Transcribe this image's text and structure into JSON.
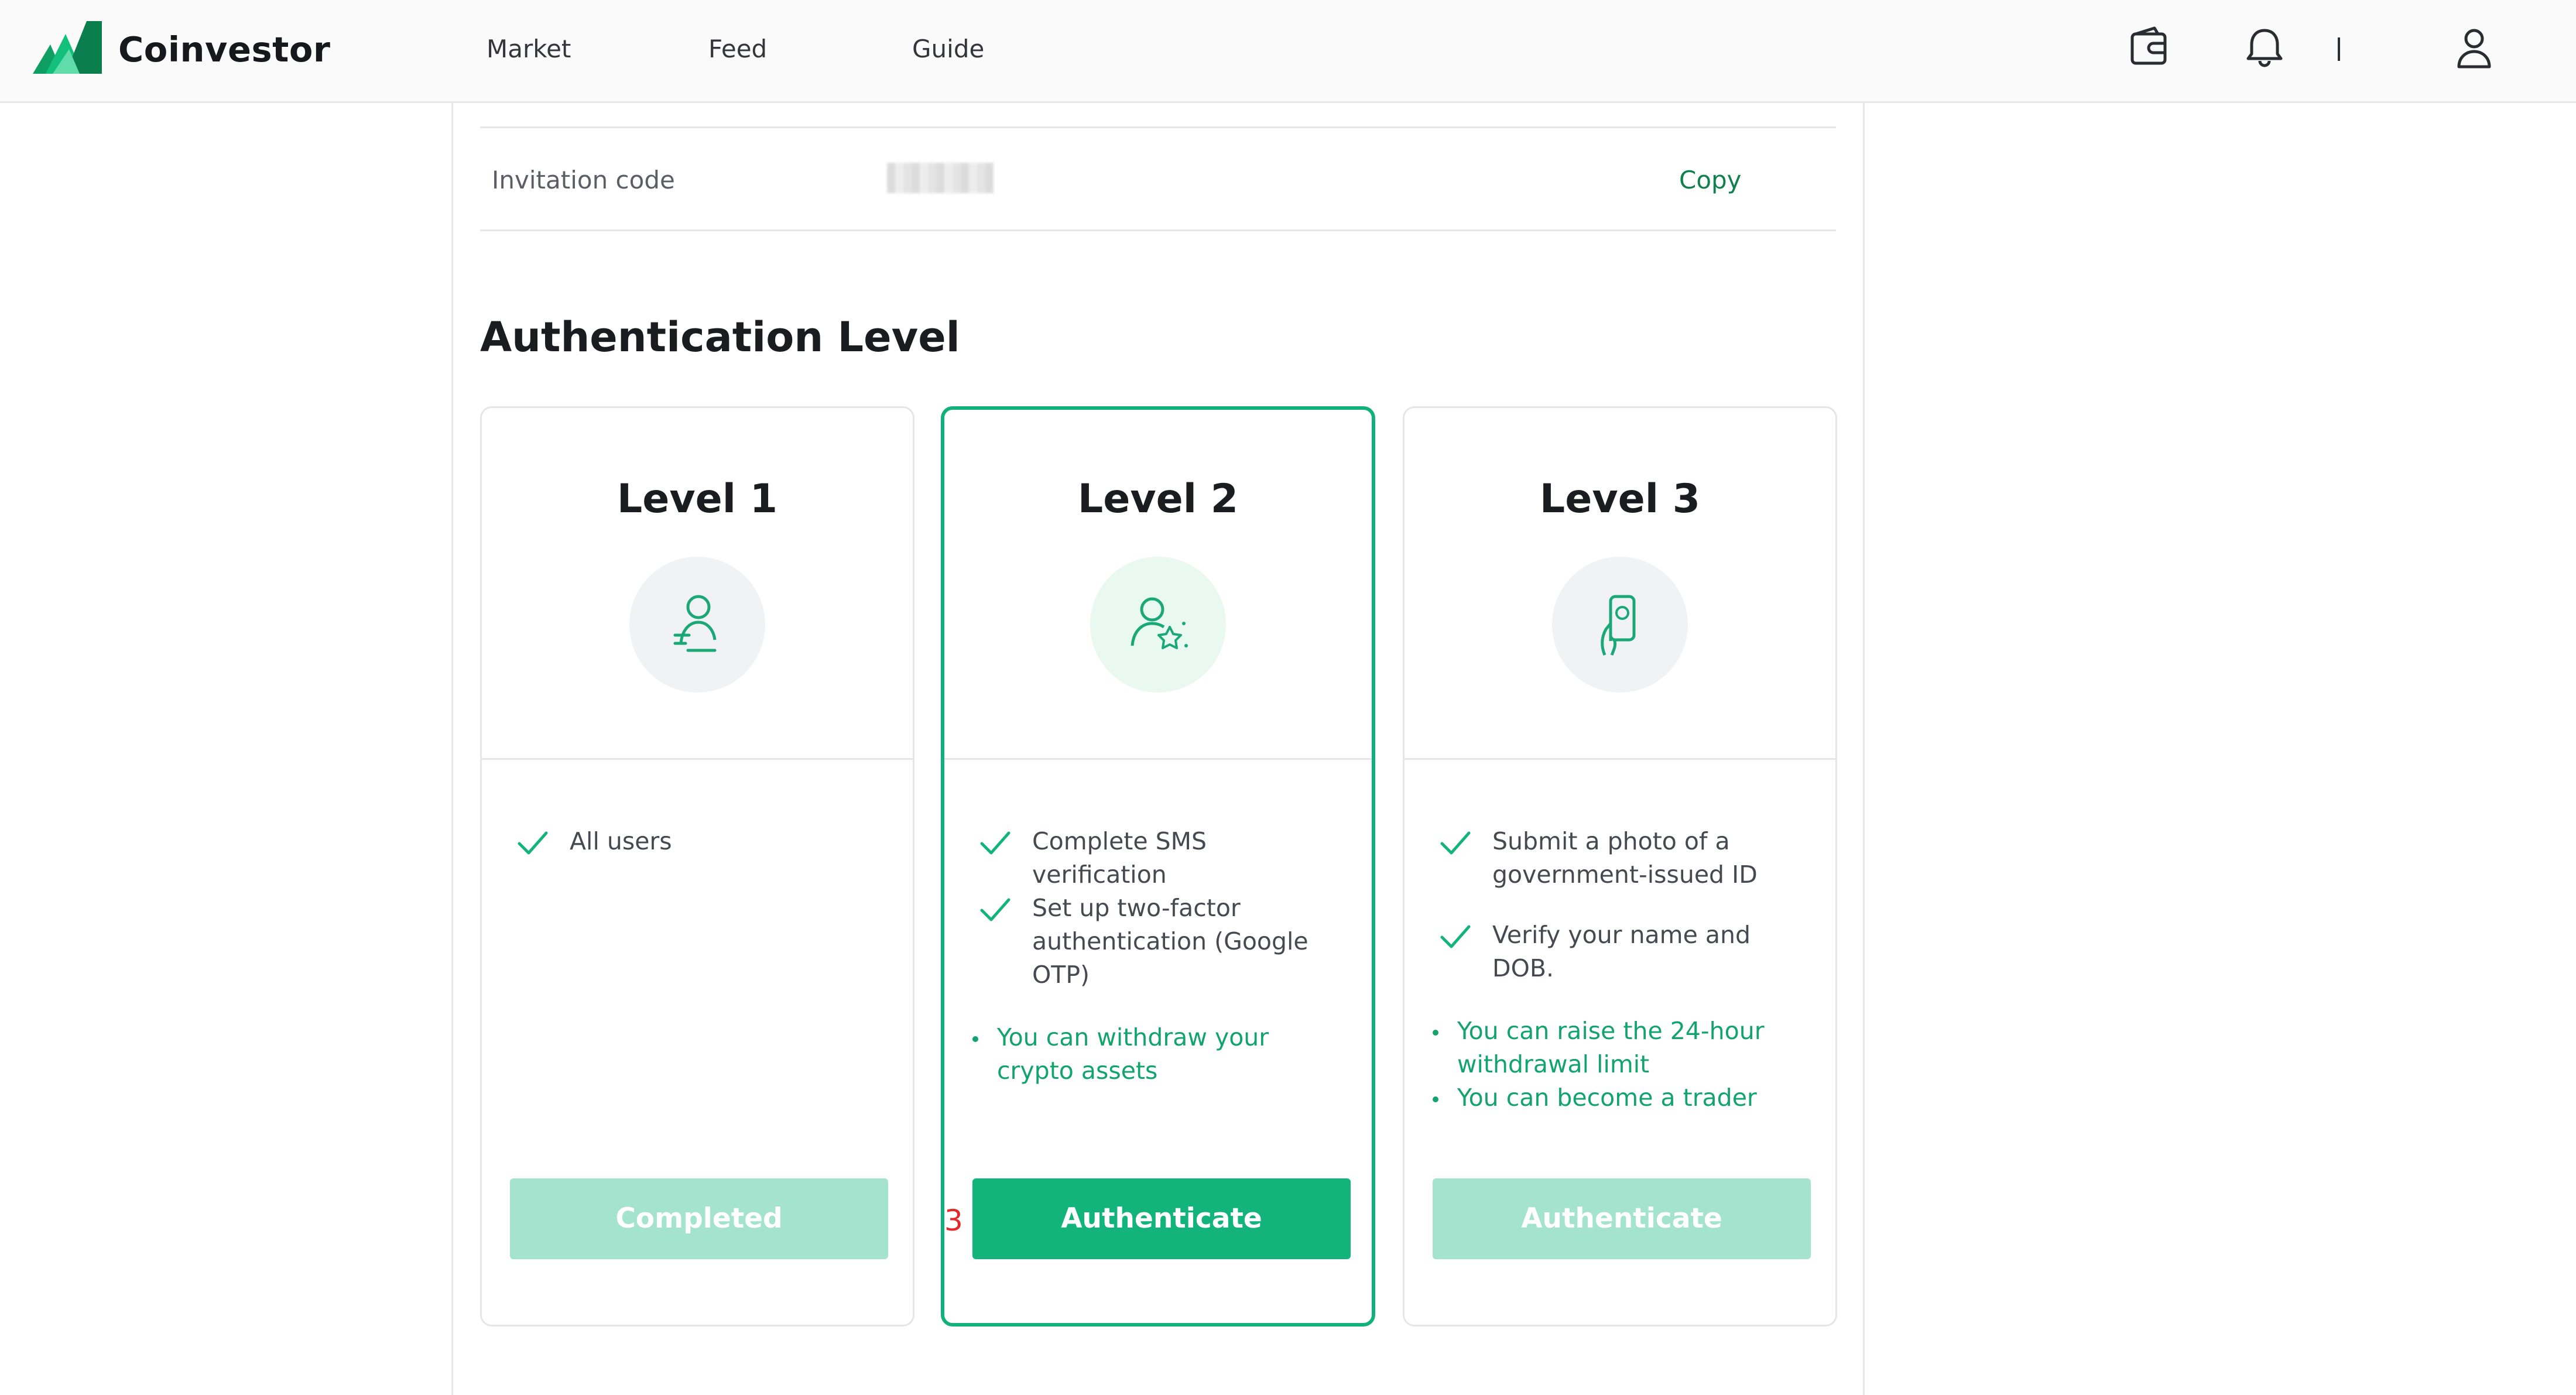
{
  "header": {
    "brand": "Coinvestor",
    "nav": [
      "Market",
      "Feed",
      "Guide"
    ],
    "icons": [
      "wallet-icon",
      "bell-icon",
      "user-icon"
    ],
    "separator": "|"
  },
  "invitation": {
    "label": "Invitation code",
    "copy_label": "Copy"
  },
  "auth": {
    "title": "Authentication Level",
    "levels": [
      {
        "title": "Level 1",
        "icon": "user-id-icon",
        "requirements": [
          "All users"
        ],
        "benefits": [],
        "button": "Completed"
      },
      {
        "title": "Level 2",
        "icon": "user-verify-icon",
        "requirements": [
          "Complete SMS verification",
          "Set up two-factor authentication (Google OTP)"
        ],
        "benefits": [
          "You can withdraw your crypto assets"
        ],
        "button": "Authenticate"
      },
      {
        "title": "Level 3",
        "icon": "phone-id-icon",
        "requirements": [
          "Submit a photo of a government-issued ID",
          "Verify your name and DOB."
        ],
        "benefits": [
          "You can raise the 24-hour withdrawal limit",
          "You can become a trader"
        ],
        "button": "Authenticate"
      }
    ]
  },
  "annotation": "3",
  "colors": {
    "accent": "#13b47b",
    "accent_soft": "#a4e3cd",
    "benefit_text": "#12a36e",
    "annotation": "#e32a2a"
  }
}
